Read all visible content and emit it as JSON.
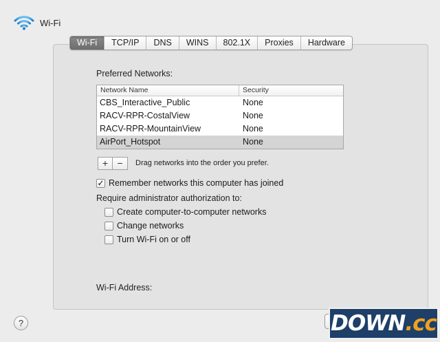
{
  "header": {
    "title": "Wi-Fi",
    "icon": "wifi-icon"
  },
  "tabs": [
    {
      "label": "Wi-Fi",
      "active": true
    },
    {
      "label": "TCP/IP"
    },
    {
      "label": "DNS"
    },
    {
      "label": "WINS"
    },
    {
      "label": "802.1X"
    },
    {
      "label": "Proxies"
    },
    {
      "label": "Hardware"
    }
  ],
  "preferred": {
    "label": "Preferred Networks:",
    "columns": [
      "Network Name",
      "Security"
    ],
    "rows": [
      {
        "name": "CBS_Interactive_Public",
        "security": "None"
      },
      {
        "name": "RACV-RPR-CostalView",
        "security": "None"
      },
      {
        "name": "RACV-RPR-MountainView",
        "security": "None"
      },
      {
        "name": "AirPort_Hotspot",
        "security": "None",
        "selected": true
      }
    ],
    "add_label": "+",
    "remove_label": "−",
    "hint": "Drag networks into the order you prefer."
  },
  "options": {
    "remember": {
      "label": "Remember networks this computer has joined",
      "checked": true
    },
    "require_label": "Require administrator authorization to:",
    "create": {
      "label": "Create computer-to-computer networks",
      "checked": false
    },
    "change": {
      "label": "Change networks",
      "checked": false
    },
    "toggle": {
      "label": "Turn Wi-Fi on or off",
      "checked": false
    }
  },
  "address": {
    "label": "Wi-Fi Address:"
  },
  "footer": {
    "help_label": "?"
  },
  "watermark": {
    "part_a": "DOWN",
    "part_b": ".cc"
  },
  "colors": {
    "active_tab": "#7a7a7a",
    "selected_row": "#d4d4d4",
    "watermark_bg": "#1d3f68",
    "watermark_accent": "#f0a01e"
  }
}
